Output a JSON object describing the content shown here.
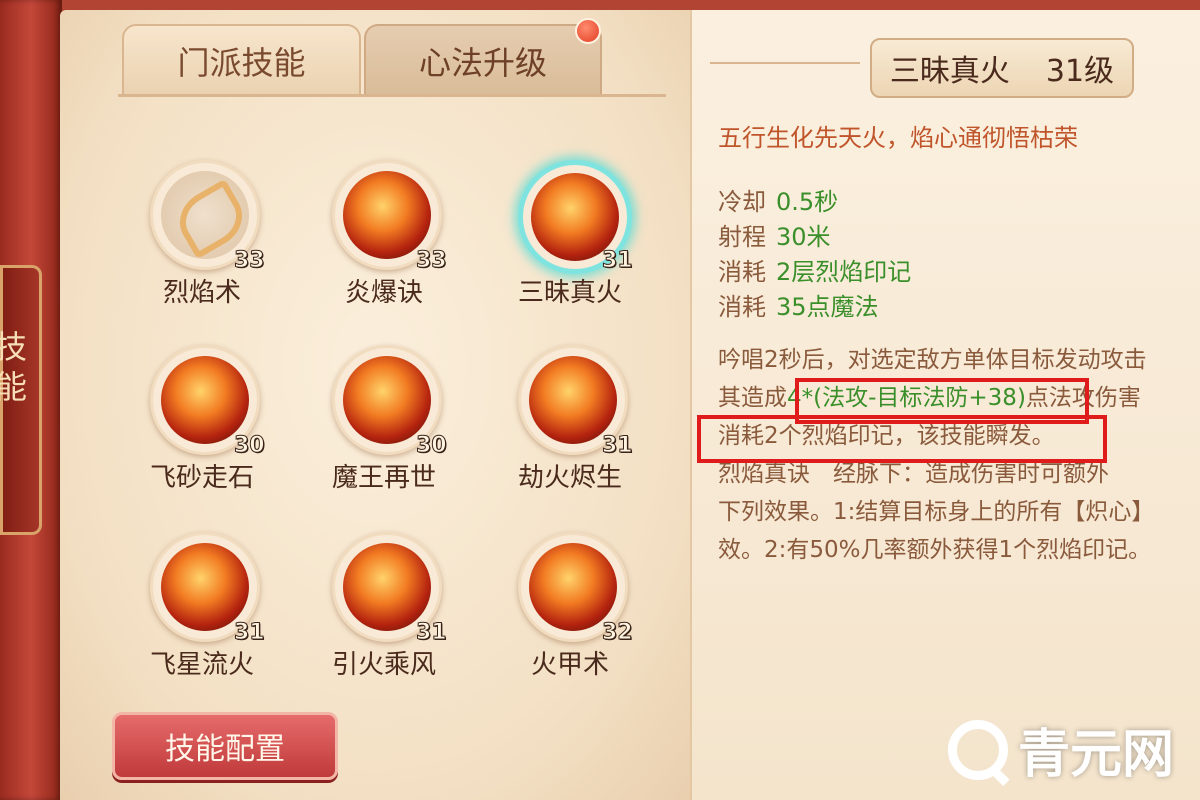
{
  "side_tab": {
    "label": "技能"
  },
  "tabs": [
    {
      "label": "门派技能"
    },
    {
      "label": "心法升级"
    }
  ],
  "skills": [
    {
      "name": "烈焰术",
      "level": "33",
      "icon": "bow-icon"
    },
    {
      "name": "炎爆诀",
      "level": "33",
      "icon": "fire-burst-icon"
    },
    {
      "name": "三昧真火",
      "level": "31",
      "icon": "true-fire-icon"
    },
    {
      "name": "飞砂走石",
      "level": "30",
      "icon": "flying-rock-icon"
    },
    {
      "name": "魔王再世",
      "level": "30",
      "icon": "demon-king-icon"
    },
    {
      "name": "劫火烬生",
      "level": "31",
      "icon": "ember-rebirth-icon"
    },
    {
      "name": "飞星流火",
      "level": "31",
      "icon": "meteor-fire-icon"
    },
    {
      "name": "引火乘风",
      "level": "31",
      "icon": "wind-fire-icon"
    },
    {
      "name": "火甲术",
      "level": "32",
      "icon": "fire-armor-icon"
    }
  ],
  "config_button": {
    "label": "技能配置"
  },
  "detail": {
    "title": "三昧真火",
    "level": "31级",
    "subtitle": "五行生化先天火，焰心通彻悟枯荣",
    "stats": [
      {
        "label": "冷却",
        "value": "0.5秒"
      },
      {
        "label": "射程",
        "value": "30米"
      },
      {
        "label": "消耗",
        "value": "2层烈焰印记"
      },
      {
        "label": "消耗",
        "value": "35点魔法"
      }
    ],
    "desc_line1": "吟唱2秒后，对选定敌方单体目标发动攻击",
    "desc_line2_pre": "其造成",
    "desc_line2_formula": "4*(法攻-目标法防+38)",
    "desc_line2_post": "点法攻伤害",
    "desc_line3": "消耗2个烈焰印记，该技能瞬发。",
    "desc_line4": "烈焰真诀　经脉下：造成伤害时可额外",
    "desc_line5": "下列效果。1:结算目标身上的所有【炽心】",
    "desc_line6": "效。2:有50%几率额外获得1个烈焰印记。"
  },
  "watermark": {
    "text": "青元网"
  }
}
